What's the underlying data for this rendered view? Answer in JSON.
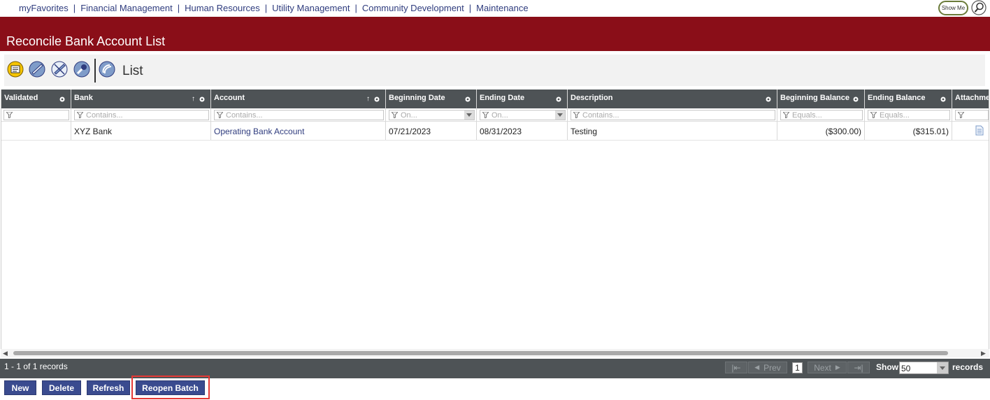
{
  "nav": {
    "items": [
      "myFavorites",
      "Financial Management",
      "Human Resources",
      "Utility Management",
      "Community Development",
      "Maintenance"
    ],
    "separator": "|",
    "show_me": "Show Me"
  },
  "page": {
    "title": "Reconcile Bank Account List"
  },
  "toolbar": {
    "icons": [
      "summary-icon",
      "validate-icon",
      "unvalidate-icon",
      "tools-icon",
      "list-view-icon"
    ],
    "view_label": "List"
  },
  "grid": {
    "columns": [
      {
        "label": "Validated",
        "filter": ""
      },
      {
        "label": "Bank",
        "filter": "Contains..."
      },
      {
        "label": "Account",
        "filter": "Contains..."
      },
      {
        "label": "Beginning Date",
        "filter": "On..."
      },
      {
        "label": "Ending Date",
        "filter": "On..."
      },
      {
        "label": "Description",
        "filter": "Contains..."
      },
      {
        "label": "Beginning Balance",
        "filter": "Equals..."
      },
      {
        "label": "Ending Balance",
        "filter": "Equals..."
      },
      {
        "label": "Attachme",
        "filter": ""
      }
    ],
    "rows": [
      {
        "validated": "",
        "bank": "XYZ Bank",
        "account": "Operating Bank Account",
        "beginning_date": "07/21/2023",
        "ending_date": "08/31/2023",
        "description": "Testing",
        "beginning_balance": "($300.00)",
        "ending_balance": "($315.01)"
      }
    ]
  },
  "pager": {
    "count": "1 - 1 of 1 records",
    "prev": "Prev",
    "next": "Next",
    "page": "1",
    "show": "Show",
    "page_size": "50",
    "records": "records"
  },
  "actions": {
    "new": "New",
    "delete": "Delete",
    "refresh": "Refresh",
    "reopen": "Reopen Batch"
  },
  "colors": {
    "header_band": "#8a0e18",
    "grid_header": "#4e5356",
    "button": "#3a4b8f",
    "highlight": "#e53935"
  }
}
